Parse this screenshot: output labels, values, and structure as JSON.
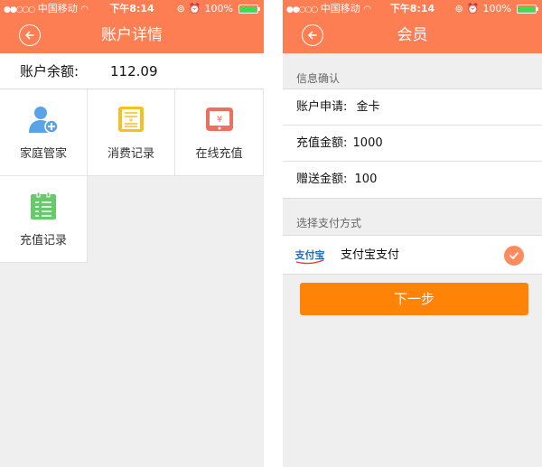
{
  "colors": {
    "accent": "#fe7e54",
    "button": "#ff8307",
    "background": "#efefef"
  },
  "left": {
    "status": {
      "carrier": "中国移动",
      "time": "下午8:14",
      "battery": "100%"
    },
    "nav": {
      "title": "账户详情",
      "back_icon": "back-arrow-circle-icon"
    },
    "balance": {
      "label": "账户余额:",
      "value": "112.09"
    },
    "tiles": [
      {
        "label": "家庭管家",
        "icon": "user-add-icon",
        "color": "#5aa3e6"
      },
      {
        "label": "消费记录",
        "icon": "receipt-icon",
        "color": "#f5c022"
      },
      {
        "label": "在线充值",
        "icon": "tablet-yen-icon",
        "color": "#ef6f5e"
      },
      {
        "label": "充值记录",
        "icon": "clipboard-icon",
        "color": "#67c96b"
      }
    ]
  },
  "right": {
    "status": {
      "carrier": "中国移动",
      "time": "下午8:14",
      "battery": "100%"
    },
    "nav": {
      "title": "会员",
      "back_icon": "back-arrow-circle-icon"
    },
    "section_info": "信息确认",
    "info_rows": [
      {
        "label": "账户申请:",
        "value": "金卡"
      },
      {
        "label": "充值金额:",
        "value": "1000"
      },
      {
        "label": "赠送金额:",
        "value": "100"
      }
    ],
    "section_pay": "选择支付方式",
    "pay": {
      "logo_text": "支付宝",
      "label": "支付宝支付"
    },
    "next_button": "下一步"
  }
}
